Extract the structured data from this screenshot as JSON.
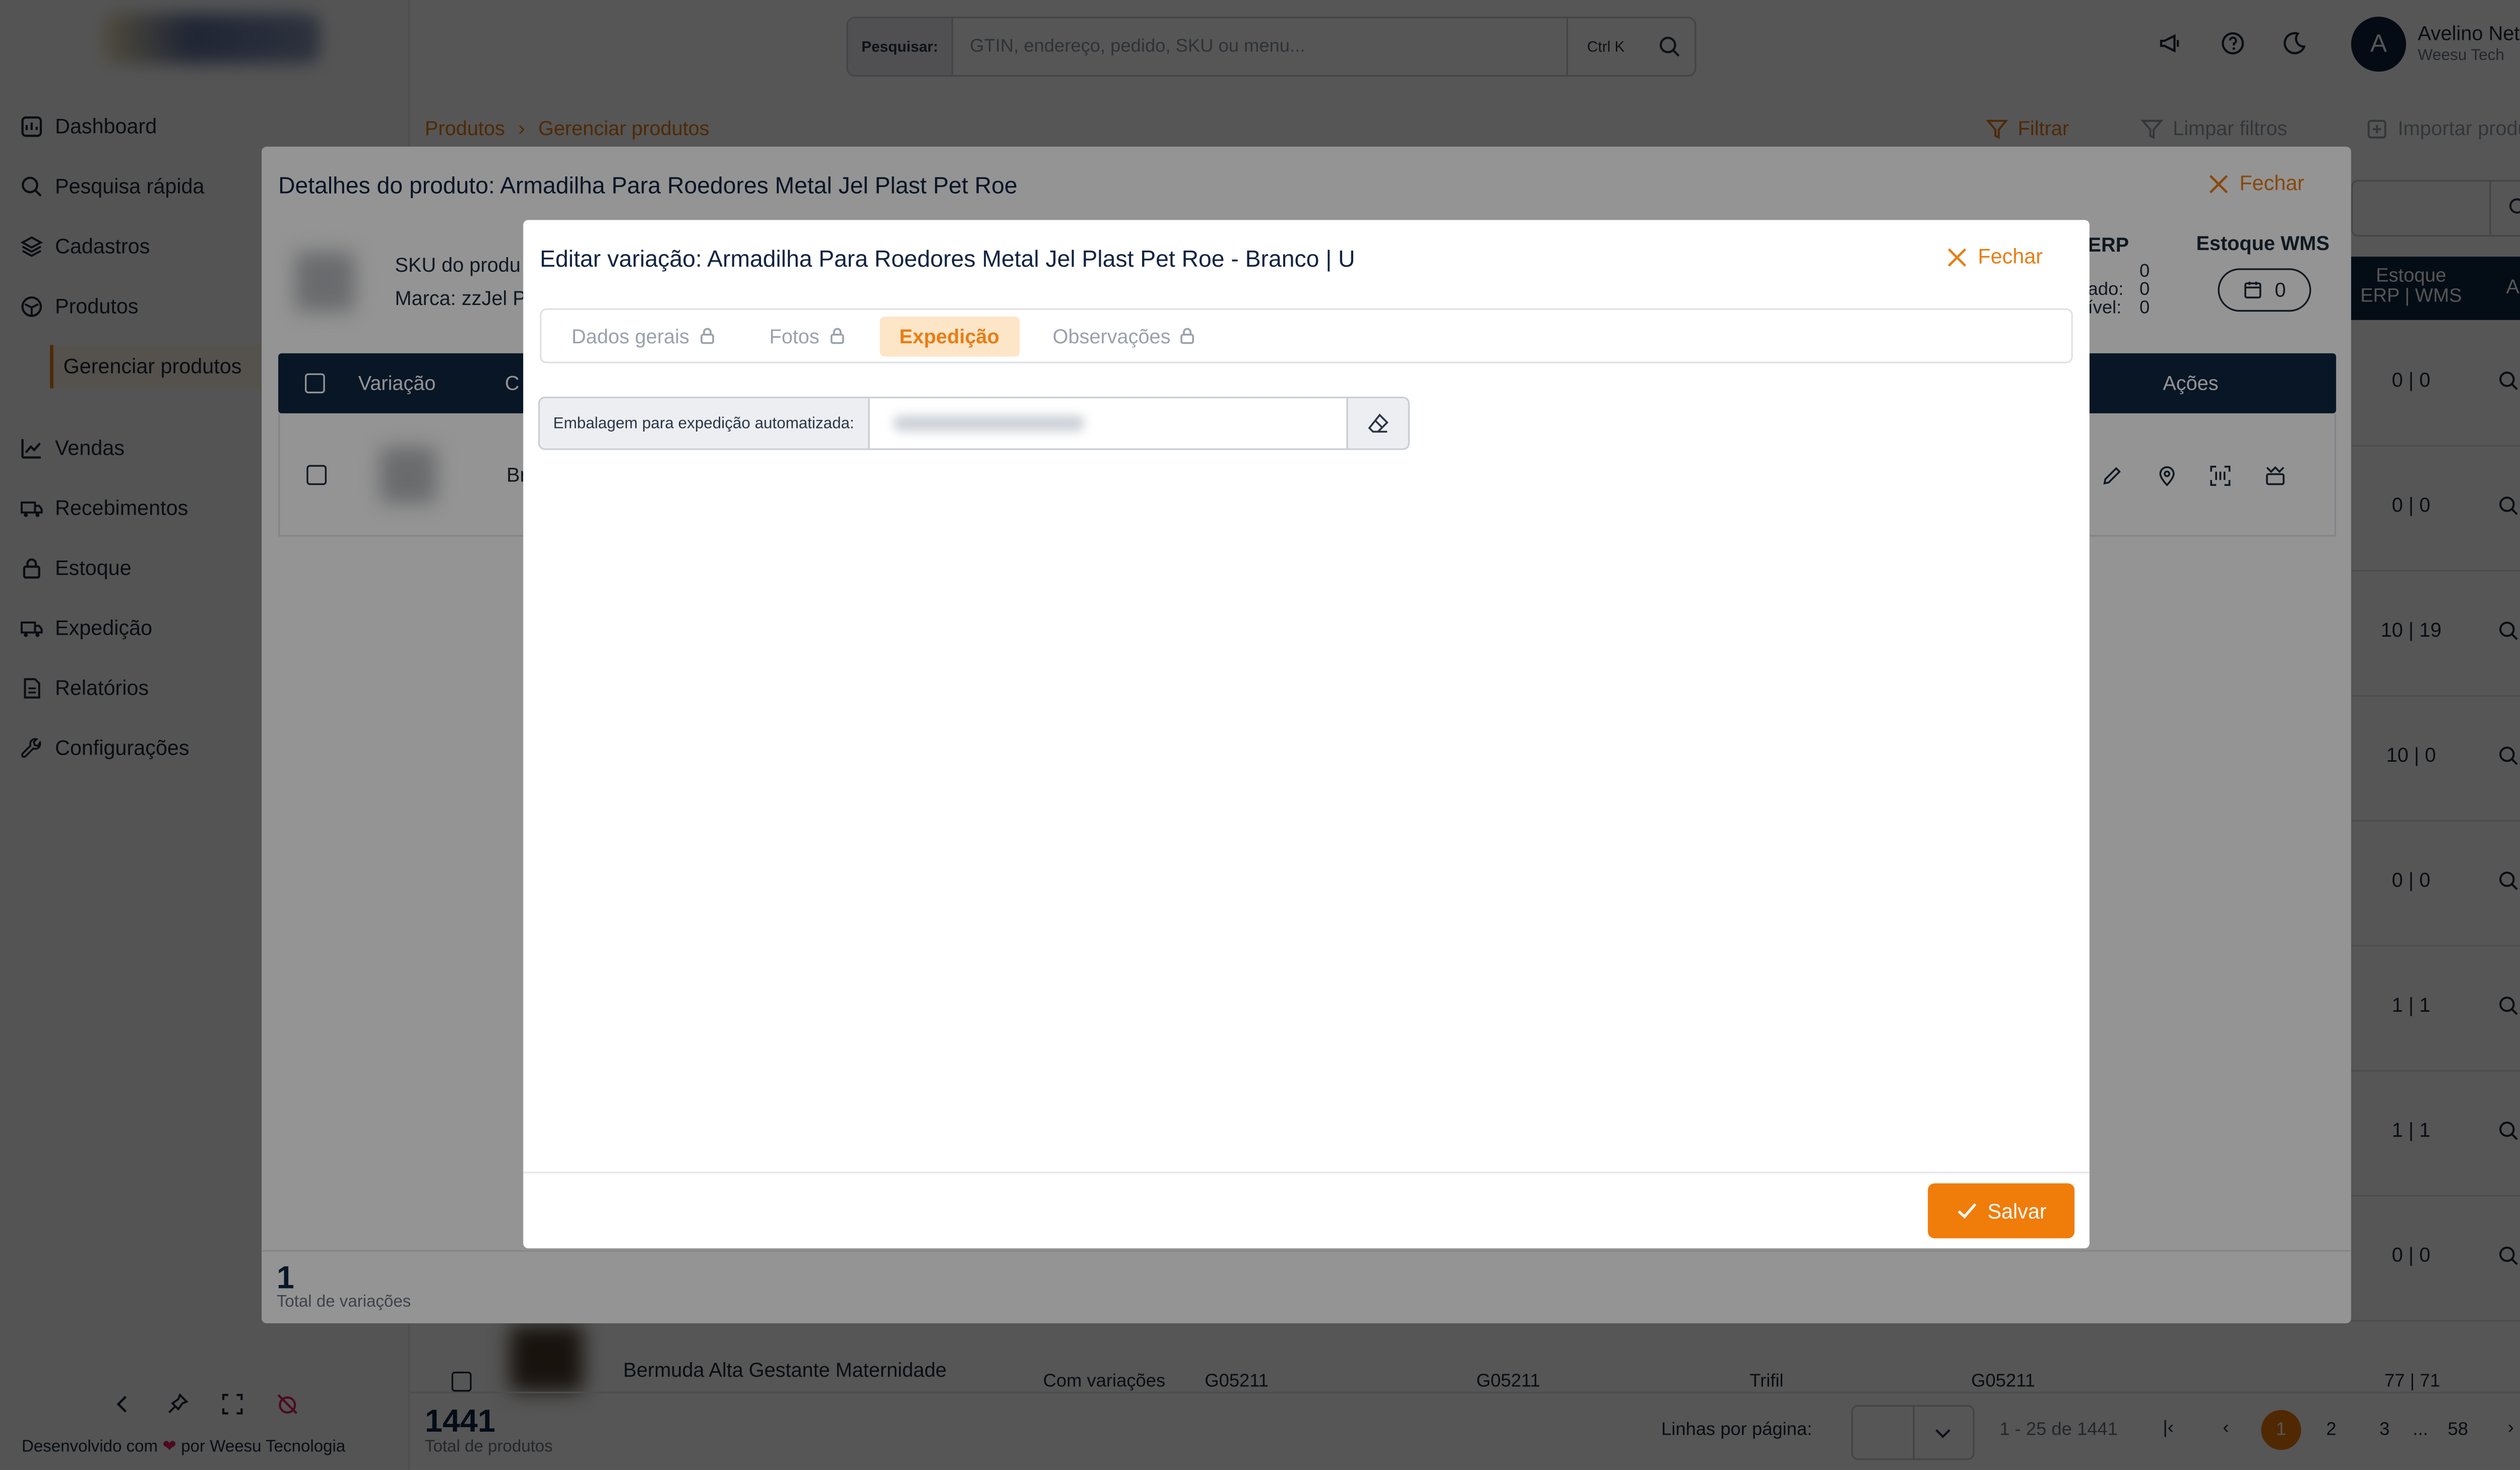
{
  "sidebar": {
    "items": [
      {
        "label": "Dashboard"
      },
      {
        "label": "Pesquisa rápida"
      },
      {
        "label": "Cadastros"
      },
      {
        "label": "Produtos"
      },
      {
        "label": "Gerenciar produtos"
      },
      {
        "label": "Vendas"
      },
      {
        "label": "Recebimentos"
      },
      {
        "label": "Estoque"
      },
      {
        "label": "Expedição"
      },
      {
        "label": "Relatórios"
      },
      {
        "label": "Configurações"
      }
    ],
    "footer_prefix": "Desenvolvido com",
    "footer_suffix": "por Weesu Tecnologia",
    "heart_color": "#e0245e"
  },
  "topbar": {
    "search_label": "Pesquisar:",
    "search_placeholder": "GTIN, endereço, pedido, SKU ou menu...",
    "search_shortcut": "Ctrl K",
    "user_initial": "A",
    "user_name": "Avelino Neto",
    "user_org": "Weesu Tech"
  },
  "page": {
    "breadcrumb": [
      "Produtos",
      "Gerenciar produtos"
    ],
    "actions": {
      "filter": "Filtrar",
      "clear": "Limpar filtros",
      "import": "Importar produto"
    },
    "right_table": {
      "header_stock": "Estoque",
      "header_stock_sub": "ERP | WMS",
      "header_actions": "Ações",
      "rows": [
        "0 | 0",
        "0 | 0",
        "10 | 19",
        "10 | 0",
        "0 | 0",
        "1 | 1",
        "1 | 1",
        "0 | 0"
      ]
    },
    "bottom_row": {
      "name": "Bermuda Alta Gestante Maternidade",
      "type": "Com variações",
      "sku1": "G05211",
      "sku2": "G05211",
      "brand": "Trifil",
      "sku3": "G05211",
      "stock": "77 | 71"
    },
    "total_count": "1441",
    "total_label": "Total de produtos",
    "rows_per_page_label": "Linhas por página:",
    "range": "1 - 25 de 1441",
    "pages": [
      "1",
      "2",
      "3",
      "...",
      "58"
    ],
    "accent_color": "#e87d14",
    "header_color": "#0f2742"
  },
  "product_modal": {
    "title": "Detalhes do produto: Armadilha Para Roedores Metal Jel Plast Pet Roe",
    "close_label": "Fechar",
    "sku_label": "SKU do produ",
    "brand_label": "Marca: zzJel P",
    "erp_label": "ERP",
    "erp_l1": "ado:",
    "erp_l2": "ível:",
    "erp_v0": "0",
    "erp_v1": "0",
    "erp_v2": "0",
    "wms_label": "Estoque WMS",
    "wms_value": "0",
    "col_variation": "Variação",
    "col_c": "C",
    "col_actions": "Ações",
    "row_text": "Br",
    "total_count": "1",
    "total_label": "Total de variações"
  },
  "edit_modal": {
    "title": "Editar variação: Armadilha Para Roedores Metal Jel Plast Pet Roe - Branco | U",
    "close_label": "Fechar",
    "tabs": [
      {
        "label": "Dados gerais",
        "locked": true,
        "active": false
      },
      {
        "label": "Fotos",
        "locked": true,
        "active": false
      },
      {
        "label": "Expedição",
        "locked": false,
        "active": true
      },
      {
        "label": "Observações",
        "locked": true,
        "active": false
      }
    ],
    "field_label": "Embalagem para expedição automatizada:",
    "save_label": "Salvar"
  }
}
